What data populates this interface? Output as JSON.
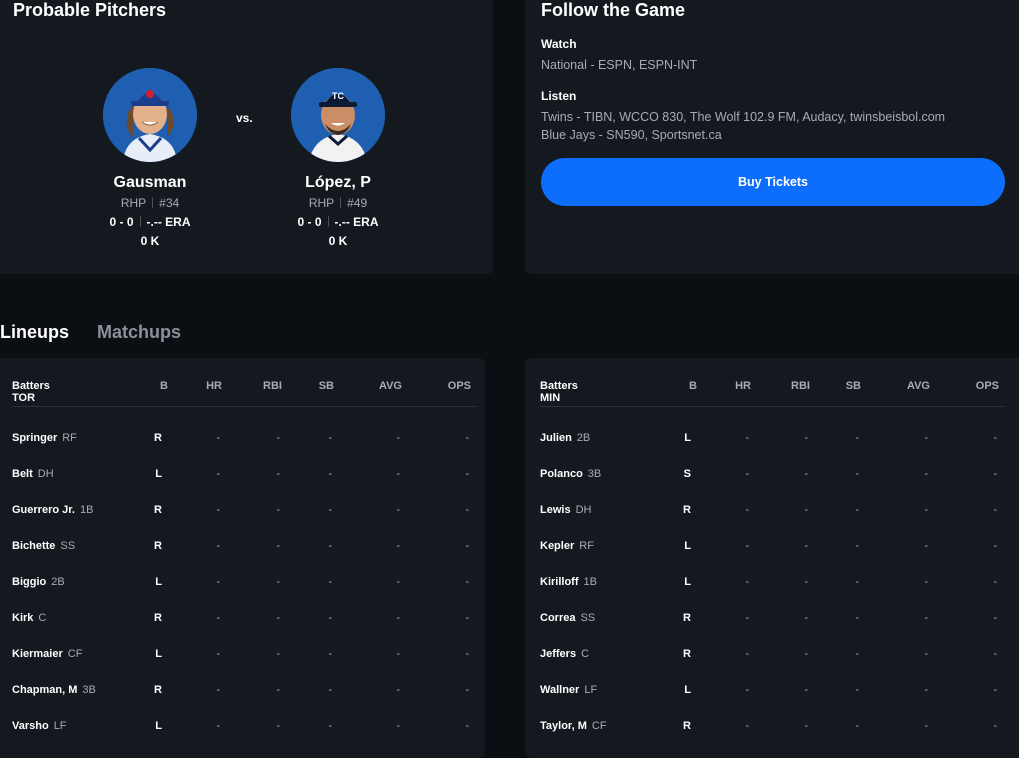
{
  "probable_pitchers": {
    "title": "Probable Pitchers",
    "vs_label": "vs.",
    "away": {
      "name": "Gausman",
      "hand": "RHP",
      "number": "#34",
      "record": "0 - 0",
      "era": "-.-- ERA",
      "strikeouts": "0 K",
      "cap_color": "#1a3e8c"
    },
    "home": {
      "name": "López, P",
      "hand": "RHP",
      "number": "#49",
      "record": "0 - 0",
      "era": "-.-- ERA",
      "strikeouts": "0 K",
      "cap_color": "#0c1a33"
    }
  },
  "follow": {
    "title": "Follow the Game",
    "watch_label": "Watch",
    "watch_text": "National - ESPN, ESPN-INT",
    "listen_label": "Listen",
    "listen_lines": [
      "Twins - TIBN, WCCO 830, The Wolf 102.9 FM, Audacy, twinsbeisbol.com",
      "Blue Jays - SN590, Sportsnet.ca"
    ],
    "buy_label": "Buy Tickets",
    "accent": "#0d6efd"
  },
  "tabs": {
    "lineups": "Lineups",
    "matchups": "Matchups"
  },
  "columns": [
    "B",
    "HR",
    "RBI",
    "SB",
    "AVG",
    "OPS"
  ],
  "lineups": [
    {
      "header": "Batters TOR",
      "batters": [
        {
          "name": "Springer",
          "pos": "RF",
          "b": "R"
        },
        {
          "name": "Belt",
          "pos": "DH",
          "b": "L"
        },
        {
          "name": "Guerrero Jr.",
          "pos": "1B",
          "b": "R"
        },
        {
          "name": "Bichette",
          "pos": "SS",
          "b": "R"
        },
        {
          "name": "Biggio",
          "pos": "2B",
          "b": "L"
        },
        {
          "name": "Kirk",
          "pos": "C",
          "b": "R"
        },
        {
          "name": "Kiermaier",
          "pos": "CF",
          "b": "L"
        },
        {
          "name": "Chapman, M",
          "pos": "3B",
          "b": "R"
        },
        {
          "name": "Varsho",
          "pos": "LF",
          "b": "L"
        }
      ]
    },
    {
      "header": "Batters MIN",
      "batters": [
        {
          "name": "Julien",
          "pos": "2B",
          "b": "L"
        },
        {
          "name": "Polanco",
          "pos": "3B",
          "b": "S"
        },
        {
          "name": "Lewis",
          "pos": "DH",
          "b": "R"
        },
        {
          "name": "Kepler",
          "pos": "RF",
          "b": "L"
        },
        {
          "name": "Kirilloff",
          "pos": "1B",
          "b": "L"
        },
        {
          "name": "Correa",
          "pos": "SS",
          "b": "R"
        },
        {
          "name": "Jeffers",
          "pos": "C",
          "b": "R"
        },
        {
          "name": "Wallner",
          "pos": "LF",
          "b": "L"
        },
        {
          "name": "Taylor, M",
          "pos": "CF",
          "b": "R"
        }
      ]
    }
  ],
  "empty_stat": "-"
}
